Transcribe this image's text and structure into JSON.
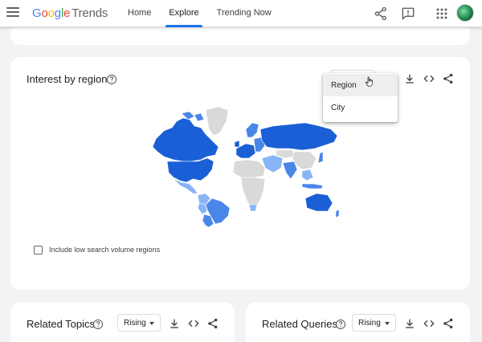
{
  "header": {
    "logo_google": [
      "G",
      "o",
      "o",
      "g",
      "l",
      "e"
    ],
    "logo_trends": "Trends",
    "nav": [
      {
        "label": "Home"
      },
      {
        "label": "Explore",
        "active": true
      },
      {
        "label": "Trending Now"
      }
    ],
    "icons": [
      "menu-icon",
      "share-icon",
      "feedback-icon",
      "apps-grid-icon",
      "account-avatar"
    ]
  },
  "interest_by_region": {
    "title": "Interest by region",
    "resolution_menu": {
      "options": [
        "Region",
        "City"
      ],
      "hovered": "Region"
    },
    "icons": [
      "help-icon",
      "download-icon",
      "embed-code-icon",
      "share-icon"
    ],
    "low_volume_checkbox": {
      "label": "Include low search volume regions",
      "checked": false
    }
  },
  "related_topics": {
    "title": "Related Topics",
    "filter": "Rising"
  },
  "related_queries": {
    "title": "Related Queries",
    "filter": "Rising"
  },
  "colors": {
    "accent": "#1a73e8",
    "map_high": "#1a5fd6",
    "map_mid": "#4a86e8",
    "map_low": "#8ab4f8",
    "map_none": "#d9d9d9"
  }
}
